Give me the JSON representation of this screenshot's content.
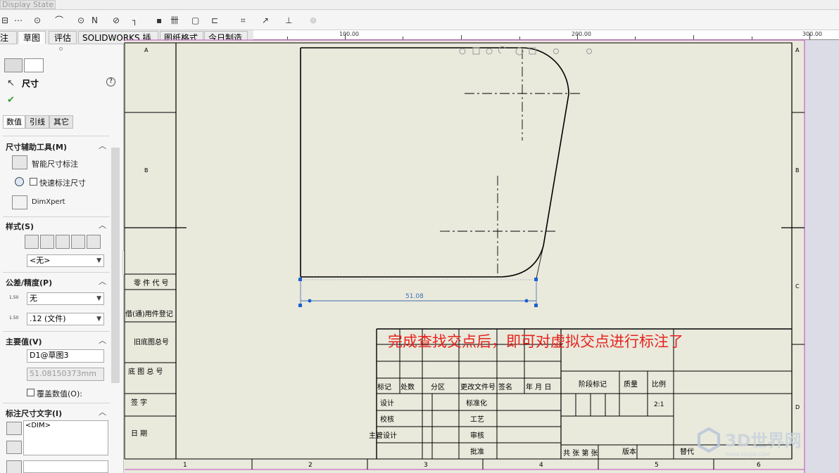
{
  "top": {
    "display_state": "Display State"
  },
  "toolbar": {
    "items": [
      "⊟",
      "⋯",
      "⊙",
      "⌒",
      "⊙",
      "N",
      "⊘",
      "┐",
      "▪",
      "卌",
      "▢",
      "⊏",
      "⌗",
      "↗",
      "⊥",
      "⊚"
    ]
  },
  "tabs": [
    {
      "label": "注解",
      "active": false
    },
    {
      "label": "草图",
      "active": true
    },
    {
      "label": "评估",
      "active": false
    },
    {
      "label": "SOLIDWORKS 插件",
      "active": false
    },
    {
      "label": "图纸格式",
      "active": false
    },
    {
      "label": "今日制造",
      "active": false
    }
  ],
  "ruler": {
    "labels": [
      "100.00",
      "200.00",
      "300.00"
    ]
  },
  "panel": {
    "title": "尺寸",
    "help": "?",
    "ok": "✔",
    "subtabs": [
      "数值",
      "引线",
      "其它"
    ],
    "dim_tools": {
      "header": "尺寸辅助工具(M)",
      "smart": "智能尺寸标注",
      "quick": "快速标注尺寸",
      "dimxpert": "DimXpert"
    },
    "style": {
      "header": "样式(S)",
      "select": "<无>"
    },
    "tolerance": {
      "header": "公差/精度(P)",
      "tol_select": "无",
      "prec_select": ".12 (文件)",
      "tol_icon_text": "1.50",
      "prec_icon_text": "1.50"
    },
    "primary": {
      "header": "主要值(V)",
      "name": "D1@草图3",
      "value": "51.08150373mm",
      "override": "覆盖数值(O):"
    },
    "dimtext": {
      "header": "标注尺寸文字(I)",
      "text": "<DIM>"
    }
  },
  "drawing": {
    "dimension": "51.08",
    "annotation": "完成查找交点后，即可对虚拟交点进行标注了",
    "zone_rows": [
      "A",
      "B",
      "C",
      "D"
    ],
    "zone_cols": [
      "1",
      "2",
      "3",
      "4",
      "5",
      "6"
    ],
    "left_block": [
      "零 件 代 号",
      "借(通)用件登记",
      "旧底图总号",
      "底 图 总 号",
      "签   字",
      "日   期"
    ],
    "title_block": {
      "header_row": [
        "标记",
        "处数",
        "分区",
        "更改文件号",
        "签名",
        "年 月 日"
      ],
      "roles_left": [
        "设计",
        "校核",
        "主管设计"
      ],
      "roles_right": [
        "标准化",
        "工艺",
        "审核",
        "批准"
      ],
      "stage": "阶段标记",
      "weight": "质量",
      "scale_label": "比例",
      "scale_value": "2:1",
      "sheets": "共  张 第  张",
      "version": "版本",
      "replace": "替代"
    },
    "watermark": "3D世界网",
    "watermark_url": "WWW.3DSJW.COM"
  },
  "colors": {
    "sheet": "#e9e9dc",
    "annotation": "#e8231d",
    "dimension": "#3e6fb0",
    "selected": "#1c5fd0",
    "watermark": "#c9d3de"
  }
}
